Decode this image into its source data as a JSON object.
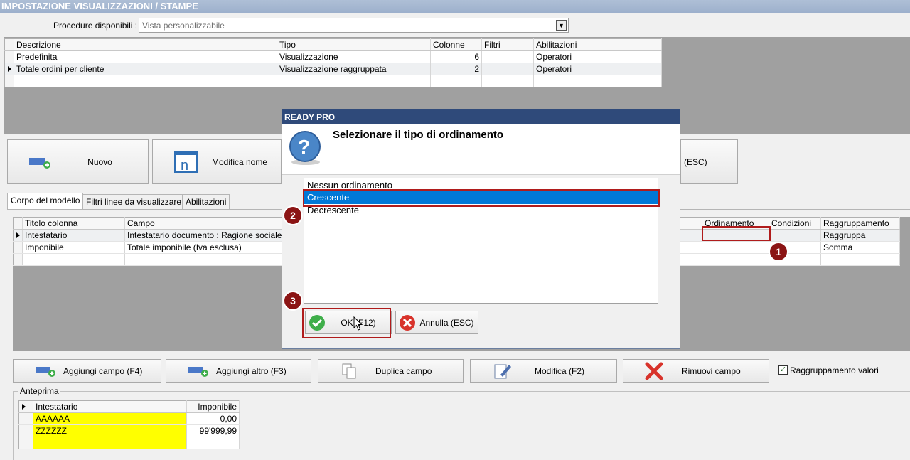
{
  "window": {
    "title": "IMPOSTAZIONE VISUALIZZAZIONI / STAMPE"
  },
  "procedure": {
    "label": "Procedure disponibili :",
    "value": "Vista personalizzabile"
  },
  "top_grid": {
    "columns": [
      "Descrizione",
      "Tipo",
      "Colonne",
      "Filtri",
      "Abilitazioni"
    ],
    "rows": [
      [
        "Predefinita",
        "Visualizzazione",
        "6",
        "",
        "Operatori"
      ],
      [
        "Totale ordini per cliente",
        "Visualizzazione raggruppata",
        "2",
        "",
        "Operatori"
      ]
    ]
  },
  "toolbar": {
    "new_label": "Nuovo",
    "rename_label": "Modifica nome",
    "esc_label": "(ESC)"
  },
  "tabs": [
    "Corpo del modello",
    "Filtri linee da visualizzare",
    "Abilitazioni"
  ],
  "fields_grid": {
    "columns": [
      "Titolo colonna",
      "Campo",
      "Ordinamento",
      "Condizioni",
      "Raggruppamento"
    ],
    "rows": [
      [
        "Intestatario",
        "Intestatario documento : Ragione sociale",
        "",
        "",
        "Raggruppa"
      ],
      [
        "Imponibile",
        "Totale imponibile (Iva esclusa)",
        "",
        "",
        "Somma"
      ]
    ]
  },
  "actions": {
    "add_field": "Aggiungi campo (F4)",
    "add_other": "Aggiungi altro (F3)",
    "duplicate": "Duplica campo",
    "edit": "Modifica (F2)",
    "remove": "Rimuovi campo",
    "group_values": "Raggruppamento valori"
  },
  "preview": {
    "label": "Anteprima",
    "columns": [
      "Intestatario",
      "Imponibile"
    ],
    "rows": [
      [
        "AAAAAA",
        "0,00"
      ],
      [
        "ZZZZZZ",
        "99'999,99"
      ]
    ]
  },
  "dialog": {
    "title": "READY PRO",
    "question": "Selezionare il tipo di ordinamento",
    "options": [
      "Nessun ordinamento",
      "Crescente",
      "Decrescente"
    ],
    "selected": "Crescente",
    "ok_label": "OK (F12)",
    "cancel_label": "Annulla (ESC)"
  },
  "callouts": [
    "1",
    "2",
    "3"
  ],
  "colors": {
    "highlight": "#0078d7",
    "callout": "#8b1414",
    "preview_yellow": "#ffff00"
  }
}
